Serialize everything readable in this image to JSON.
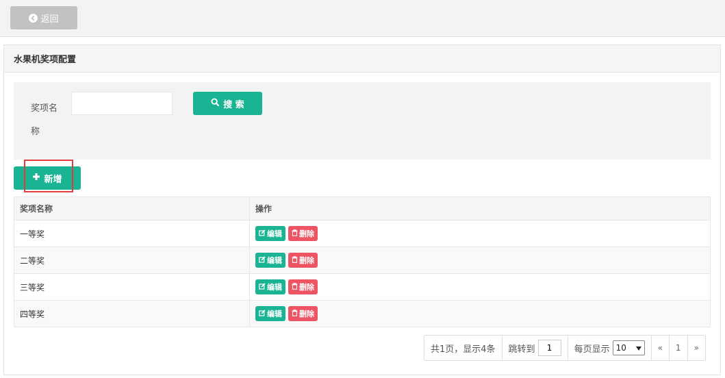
{
  "topbar": {
    "back_label": "返回"
  },
  "panel": {
    "title": "水果机奖项配置"
  },
  "search": {
    "label": "奖项名称",
    "value": "",
    "placeholder": "",
    "button_label": "搜 索"
  },
  "toolbar": {
    "add_label": "新增"
  },
  "table": {
    "headers": [
      "奖项名称",
      "操作"
    ],
    "rows": [
      {
        "name": "一等奖"
      },
      {
        "name": "二等奖"
      },
      {
        "name": "三等奖"
      },
      {
        "name": "四等奖"
      }
    ],
    "edit_label": "编辑",
    "delete_label": "删除"
  },
  "pager": {
    "summary": "共1页，显示4条",
    "jump_label": "跳转到",
    "jump_value": "1",
    "size_label": "每页显示",
    "size_value": "10",
    "first": "«",
    "current": "1",
    "last": "»"
  },
  "colors": {
    "primary": "#1ab394",
    "danger": "#ed5565",
    "back": "#c2c2c2",
    "highlight": "#e23b3b"
  }
}
